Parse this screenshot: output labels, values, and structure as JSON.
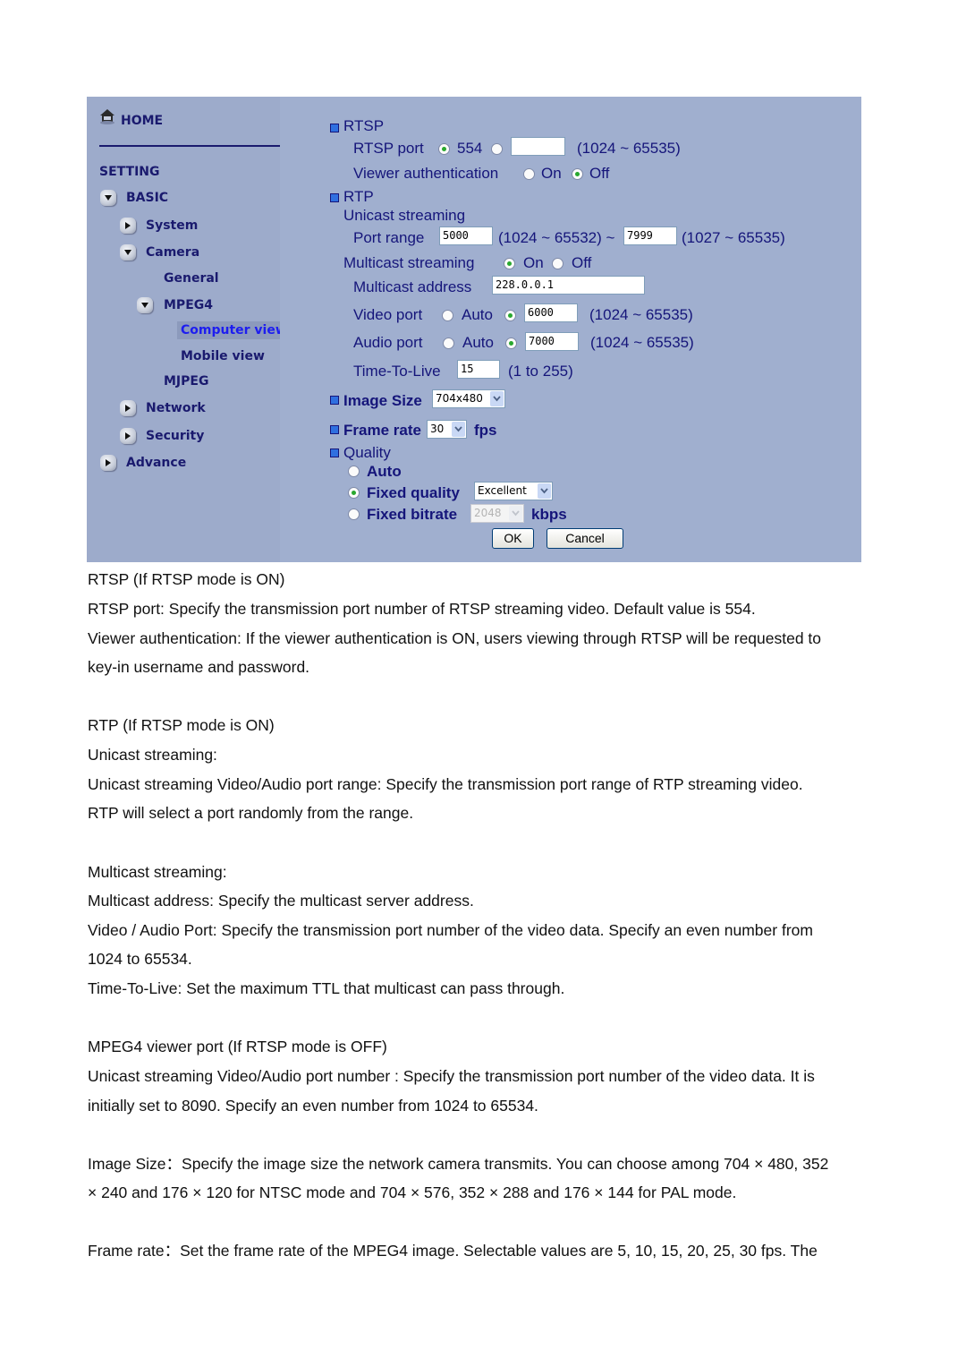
{
  "sidebar": {
    "home": "HOME",
    "setting": "SETTING",
    "basic": "BASIC",
    "system": "System",
    "camera": "Camera",
    "general": "General",
    "mpeg4": "MPEG4",
    "computer_view": "Computer view",
    "mobile_view": "Mobile view",
    "mjpeg": "MJPEG",
    "network": "Network",
    "security": "Security",
    "advance": "Advance"
  },
  "form": {
    "rtsp": {
      "title": "RTSP",
      "port_label": "RTSP port",
      "port_default": "554",
      "port_custom_value": "",
      "port_range": "(1024 ~ 65535)",
      "port_selected": "default",
      "auth_label": "Viewer authentication",
      "auth_on": "On",
      "auth_off": "Off",
      "auth_selected": "Off"
    },
    "rtp": {
      "title": "RTP",
      "unicast_label": "Unicast streaming",
      "port_range_label": "Port range",
      "port_from": "5000",
      "port_from_range": "(1024 ~ 65532) ~",
      "port_to": "7999",
      "port_to_range": "(1027 ~ 65535)",
      "multicast_label": "Multicast streaming",
      "multicast_on": "On",
      "multicast_off": "Off",
      "multicast_selected": "On",
      "address_label": "Multicast address",
      "address_value": "228.0.0.1",
      "video_port_label": "Video port",
      "video_auto": "Auto",
      "video_port_value": "6000",
      "video_range": "(1024 ~ 65535)",
      "audio_port_label": "Audio port",
      "audio_auto": "Auto",
      "audio_port_value": "7000",
      "audio_range": "(1024 ~ 65535)",
      "ttl_label": "Time-To-Live",
      "ttl_value": "15",
      "ttl_range": "(1 to 255)"
    },
    "image_size": {
      "label": "Image Size",
      "value": "704x480"
    },
    "frame_rate": {
      "label": "Frame rate",
      "value": "30",
      "unit": "fps"
    },
    "quality": {
      "title": "Quality",
      "auto": "Auto",
      "fixed_quality": "Fixed quality",
      "fixed_quality_value": "Excellent",
      "fixed_bitrate": "Fixed bitrate",
      "fixed_bitrate_value": "2048",
      "bitrate_unit": "kbps",
      "selected": "Fixed quality"
    },
    "ok": "OK",
    "cancel": "Cancel"
  },
  "colors": {
    "panel_bg": "#a2b0d0",
    "nav_text": "#1a1a6e",
    "nav_selected": "#1d1df0",
    "radio_dot": "#29a82e"
  },
  "doc": {
    "lines": [
      "RTSP (If RTSP mode is ON)",
      "RTSP port: Specify the transmission port number of RTSP streaming video. Default value is 554.",
      "Viewer authentication: If the viewer authentication is ON, users viewing through RTSP will be requested to",
      "key-in username and password.",
      "RTP (If RTSP mode is ON)",
      "Unicast streaming:",
      "Unicast streaming Video/Audio port range: Specify the transmission port range of RTP streaming video.",
      "RTP will select a port randomly from the range.",
      "Multicast streaming:",
      "Multicast address: Specify the multicast server address.",
      "Video / Audio Port: Specify the transmission port number of the video data. Specify an even number from",
      "1024 to 65534.",
      "Time-To-Live: Set the maximum TTL that multicast can pass through.",
      "MPEG4 viewer port (If RTSP mode is OFF)",
      "Unicast streaming Video/Audio port number : Specify the transmission port number of the video data. It is",
      "initially set to 8090. Specify an even number from 1024 to 65534.",
      "Image Size：Specify the image size the network camera transmits. You can choose among 704 × 480, 352",
      "× 240 and 176 × 120 for NTSC mode and 704 × 576, 352 × 288 and 176 × 144 for PAL mode.",
      "Frame rate：Set the frame rate of the MPEG4 image. Selectable values are 5, 10, 15, 20, 25, 30 fps. The"
    ]
  }
}
